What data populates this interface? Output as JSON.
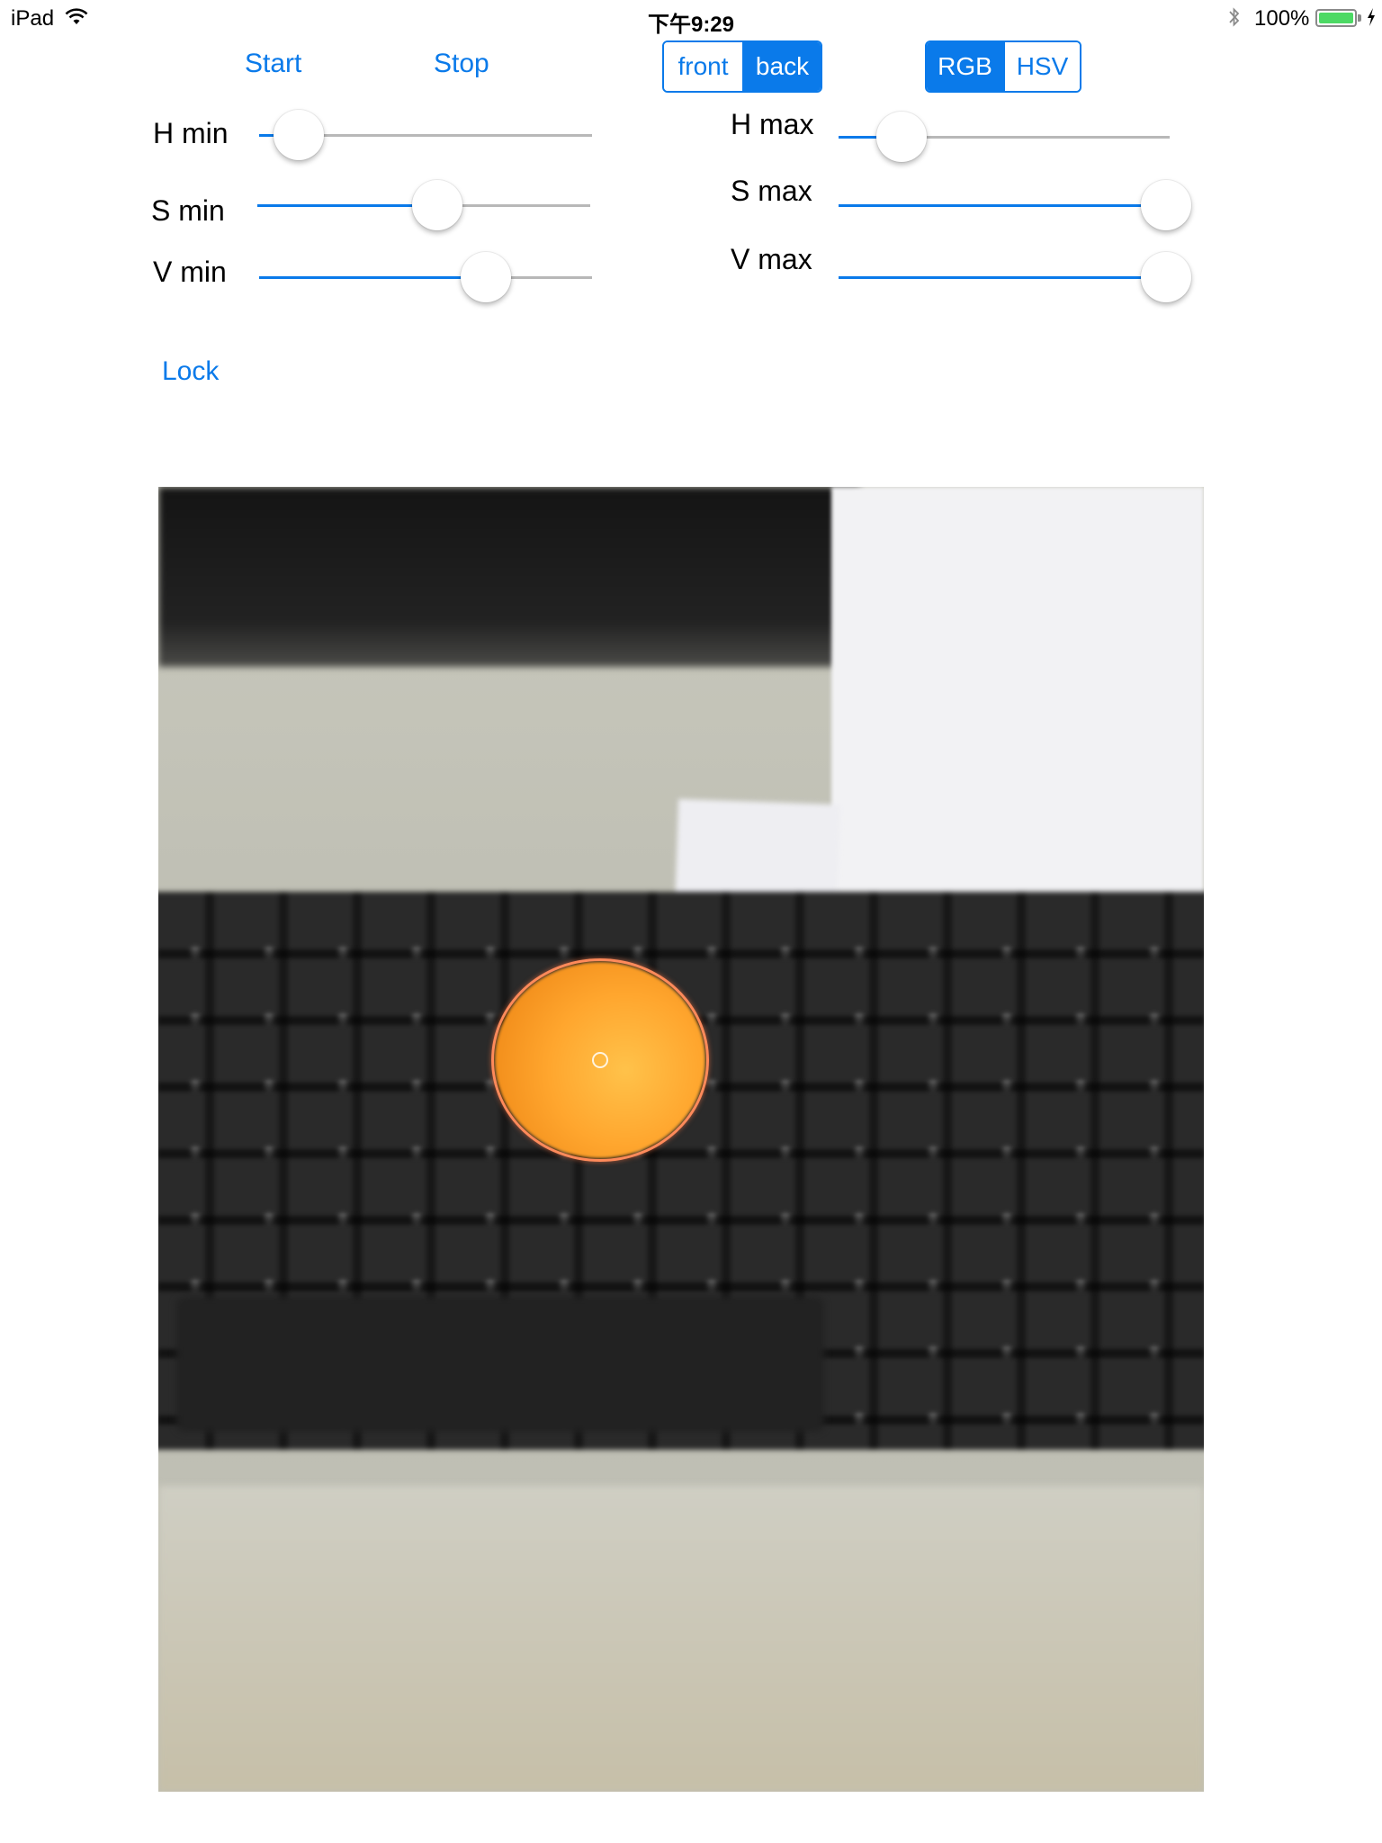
{
  "status_bar": {
    "device": "iPad",
    "time": "下午9:29",
    "battery_percent": "100%",
    "battery_level": 1.0
  },
  "controls": {
    "start_label": "Start",
    "stop_label": "Stop",
    "lock_label": "Lock",
    "camera_segment": [
      {
        "label": "front",
        "selected": false
      },
      {
        "label": "back",
        "selected": true
      }
    ],
    "mode_segment": [
      {
        "label": "RGB",
        "selected": true
      },
      {
        "label": "HSV",
        "selected": false
      }
    ]
  },
  "sliders": [
    {
      "label": "H min",
      "value": 0.12
    },
    {
      "label": "S min",
      "value": 0.54
    },
    {
      "label": "V min",
      "value": 0.68
    },
    {
      "label": "H max",
      "value": 0.19
    },
    {
      "label": "S max",
      "value": 0.99
    },
    {
      "label": "V max",
      "value": 0.99
    }
  ],
  "colors": {
    "accent": "#0a7aea",
    "track": "#b8b8b8",
    "battery": "#4cd964",
    "detection_ring": "#ff8a5a"
  },
  "icons": {
    "wifi": "wifi-icon",
    "bluetooth": "bluetooth-icon",
    "battery": "battery-icon",
    "charging": "charging-bolt-icon"
  }
}
